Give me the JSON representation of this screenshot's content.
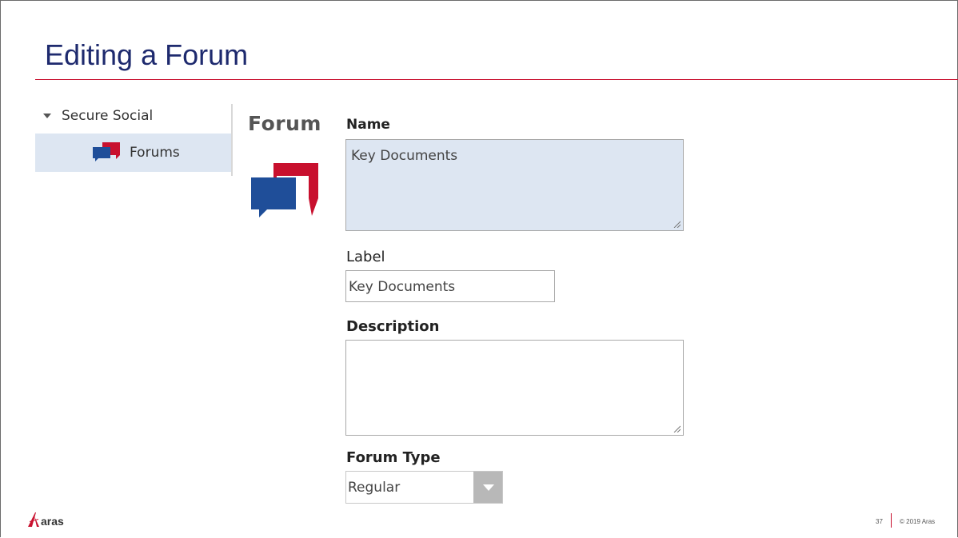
{
  "slide": {
    "title": "Editing a Forum"
  },
  "tree": {
    "root_label": "Secure Social",
    "child_label": "Forums"
  },
  "form": {
    "heading": "Forum",
    "name": {
      "label": "Name",
      "value": "Key Documents"
    },
    "label_field": {
      "label": "Label",
      "value": "Key Documents"
    },
    "description": {
      "label": "Description",
      "value": ""
    },
    "forum_type": {
      "label": "Forum Type",
      "value": "Regular"
    }
  },
  "footer": {
    "logo_text": "aras",
    "page_number": "37",
    "copyright": "© 2019 Aras"
  },
  "colors": {
    "title": "#1e2a6e",
    "accent_red": "#c8102e",
    "forum_blue": "#1f4e99",
    "selection": "#dde6f2"
  },
  "icons": [
    "caret-down-icon",
    "forum-chat-icon",
    "resize-grip-icon",
    "dropdown-arrow-icon",
    "aras-logo-icon"
  ]
}
